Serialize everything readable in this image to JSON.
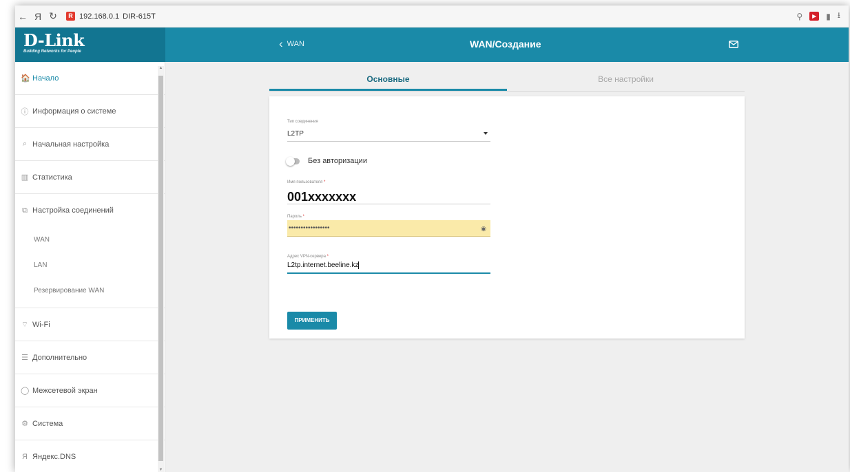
{
  "browser": {
    "url": "192.168.0.1",
    "title": "DIR-615T",
    "back_icon": "←",
    "yandex_icon": "Я",
    "reload_icon": "↻",
    "favicon": "R",
    "download_icon": "⭳"
  },
  "header": {
    "logo": "D-Link",
    "logo_tagline": "Building Networks for People",
    "back_label": "WAN",
    "title": "WAN/Создание"
  },
  "sidebar": {
    "items": [
      {
        "label": "Начало",
        "icon": "home-icon",
        "glyph": "🏠"
      },
      {
        "label": "Информация о системе",
        "icon": "info-icon",
        "glyph": "ⓘ"
      },
      {
        "label": "Начальная настройка",
        "icon": "wizard-icon",
        "glyph": "⌕"
      },
      {
        "label": "Статистика",
        "icon": "stats-icon",
        "glyph": "▥"
      },
      {
        "label": "Настройка соединений",
        "icon": "connections-icon",
        "glyph": "⧉"
      },
      {
        "label": "Wi-Fi",
        "icon": "wifi-icon",
        "glyph": "⌔"
      },
      {
        "label": "Дополнительно",
        "icon": "advanced-icon",
        "glyph": "☰"
      },
      {
        "label": "Межсетевой экран",
        "icon": "shield-icon",
        "glyph": "◯"
      },
      {
        "label": "Система",
        "icon": "gear-icon",
        "glyph": "⚙"
      },
      {
        "label": "Яндекс.DNS",
        "icon": "yandex-icon",
        "glyph": "Я"
      }
    ],
    "sub_items": [
      "WAN",
      "LAN",
      "Резервирование WAN"
    ]
  },
  "tabs": {
    "basic": "Основные",
    "all": "Все настройки"
  },
  "form": {
    "connection_type_label": "Тип соединения",
    "connection_type_value": "L2TP",
    "no_auth_label": "Без авторизации",
    "username_label": "Имя пользователя",
    "username_value": "001xxxxxxx",
    "password_label": "Пароль",
    "password_value": "•••••••••••••••••",
    "vpn_label": "Адрес VPN-сервера",
    "vpn_value": "L2tp.internet.beeline.kz",
    "required_mark": "*",
    "apply_label": "ПРИМЕНИТЬ"
  },
  "colors": {
    "accent": "#1a8aa8",
    "header_dark": "#127591",
    "autofill": "#faeaa9"
  }
}
